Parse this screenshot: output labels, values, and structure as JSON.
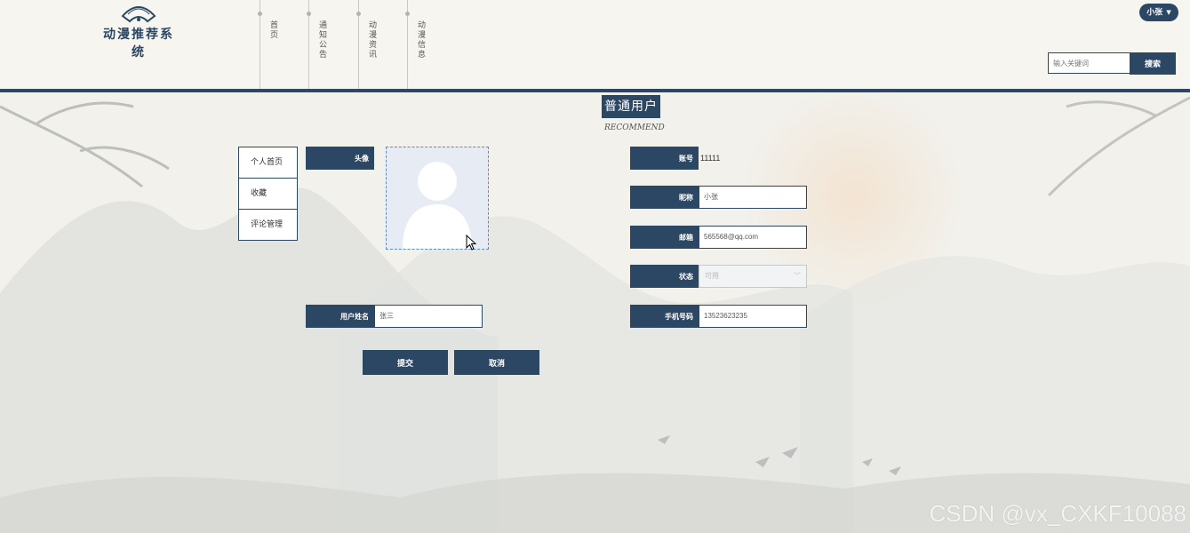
{
  "app": {
    "title": "动漫推荐系统",
    "logo_icon": "fan-logo-icon"
  },
  "nav": {
    "items": [
      {
        "label": "首页"
      },
      {
        "label": "通知公告"
      },
      {
        "label": "动漫资讯"
      },
      {
        "label": "动漫信息"
      }
    ]
  },
  "user_menu": {
    "username": "小张",
    "caret_icon": "caret-down-icon"
  },
  "search": {
    "placeholder": "输入关键词",
    "button_label": "搜索"
  },
  "page": {
    "title": "普通用户",
    "subtitle": "RECOMMEND"
  },
  "side_menu": {
    "items": [
      {
        "label": "个人首页"
      },
      {
        "label": "收藏"
      },
      {
        "label": "评论管理"
      }
    ]
  },
  "form": {
    "avatar_label": "头像",
    "avatar_icon": "user-silhouette-icon",
    "name_label": "用户姓名",
    "name_value": "张三",
    "account_label": "账号",
    "account_value": "11111",
    "nickname_label": "昵称",
    "nickname_value": "小张",
    "email_label": "邮箱",
    "email_value": "565568@qq.com",
    "status_label": "状态",
    "status_value": "可用",
    "phone_label": "手机号码",
    "phone_value": "13523623235",
    "submit_label": "提交",
    "cancel_label": "取消"
  },
  "watermark": "CSDN @vx_CXKF10088",
  "colors": {
    "primary": "#2b4763",
    "background": "#f2f1ec"
  }
}
